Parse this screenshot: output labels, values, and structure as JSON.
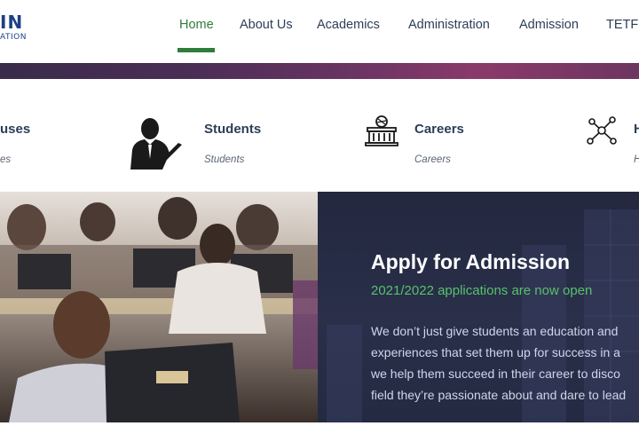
{
  "header": {
    "logo": {
      "main": "IN",
      "sub": "ATION"
    },
    "nav": [
      {
        "label": "Home",
        "active": true
      },
      {
        "label": "About Us",
        "active": false
      },
      {
        "label": "Academics",
        "active": false
      },
      {
        "label": "Administration",
        "active": false
      },
      {
        "label": "Admission",
        "active": false
      },
      {
        "label": "TETFund",
        "active": false
      }
    ]
  },
  "quick_links": [
    {
      "title": "uses",
      "subtitle": "es",
      "icon": "campuses-icon"
    },
    {
      "title": "Students",
      "subtitle": "Students",
      "icon": "student-icon"
    },
    {
      "title": "Careers",
      "subtitle": "Careers",
      "icon": "building-icon"
    },
    {
      "title": "H",
      "subtitle": "H",
      "icon": "network-icon"
    }
  ],
  "hero": {
    "title": "Apply for Admission",
    "subtitle": "2021/2022 applications are now open",
    "body_lines": [
      "We don’t just give students an education and",
      "experiences that set them up for success in a",
      "we help them succeed in their career to disco",
      "field they’re passionate about and dare to lead"
    ]
  },
  "colors": {
    "brand_blue": "#1f3f86",
    "nav_active": "#2f7d3b",
    "panel_bg": "#23283f",
    "accent_green": "#57c26b"
  }
}
